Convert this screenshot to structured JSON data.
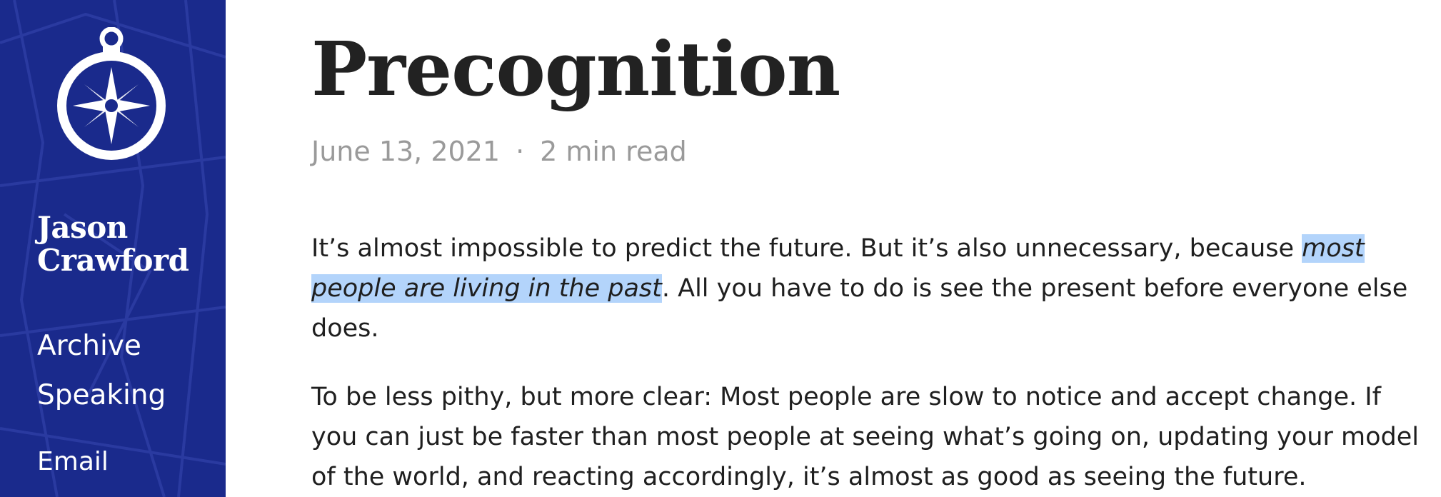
{
  "sidebar": {
    "author": "Jason Crawford",
    "nav": {
      "archive": "Archive",
      "speaking": "Speaking",
      "email": "Email"
    },
    "colors": {
      "background": "#1a2a8c",
      "text": "#ffffff"
    },
    "logo_icon": "compass-icon"
  },
  "post": {
    "title": "Precognition",
    "date": "June 13, 2021",
    "separator": "·",
    "read_time": "2 min read",
    "p1": {
      "before": "It’s almost impossible to predict the future. But it’s also unnecessary, because ",
      "highlight": "most people are living in the past",
      "after": ". All you have to do is see the present before everyone else does."
    },
    "p2": "To be less pithy, but more clear: Most people are slow to notice and accept change. If you can just be faster than most people at seeing what’s going on, updating your model of the world, and reacting accordingly, it’s almost as good as seeing the future.",
    "highlight_color": "#b3d4fb"
  }
}
